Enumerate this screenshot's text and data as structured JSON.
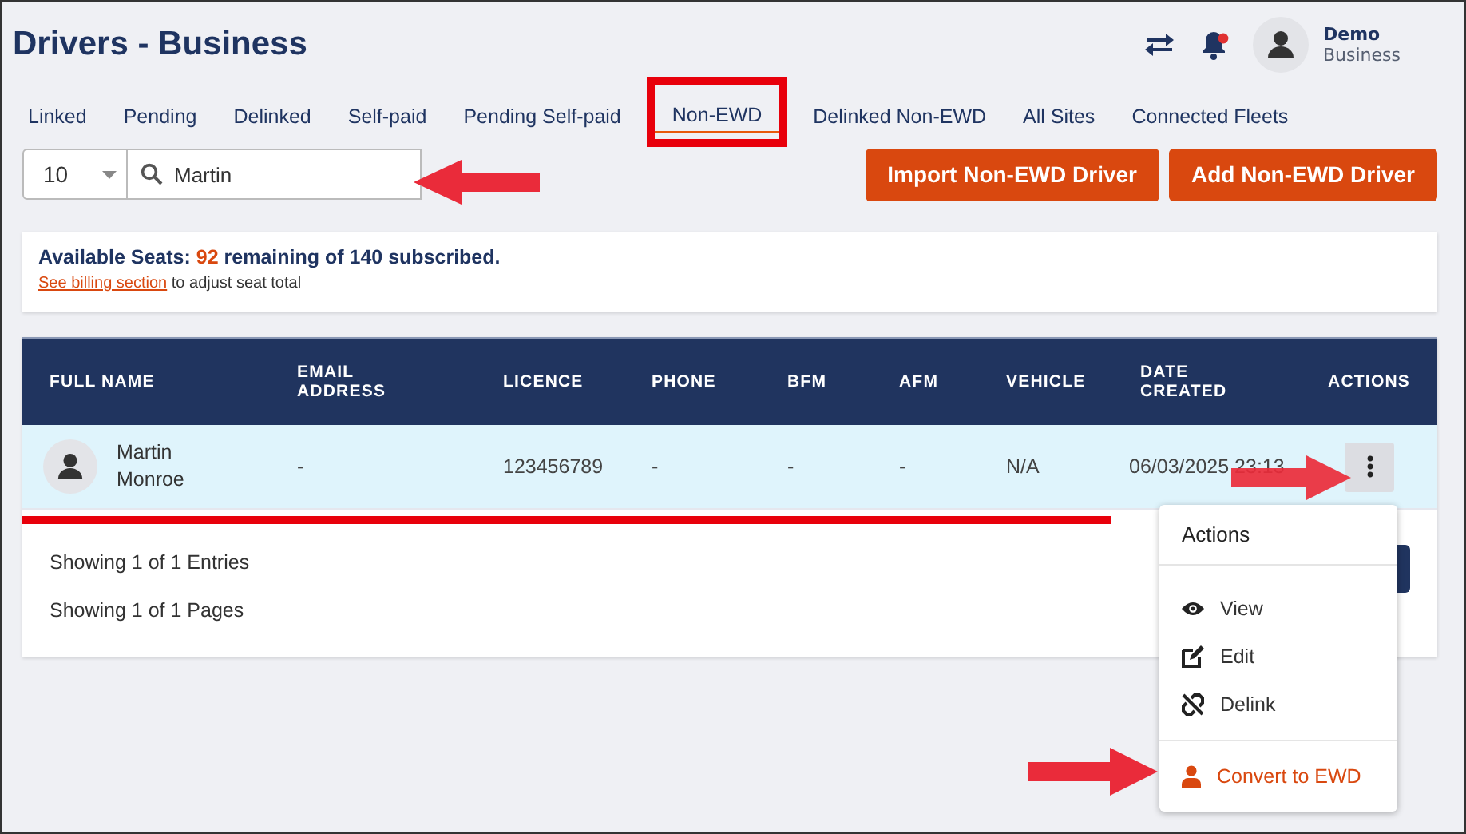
{
  "header": {
    "title": "Drivers - Business",
    "notification_dot": true,
    "user": {
      "name": "Demo",
      "role": "Business"
    }
  },
  "tabs": [
    {
      "label": "Linked",
      "selected": false
    },
    {
      "label": "Pending",
      "selected": false
    },
    {
      "label": "Delinked",
      "selected": false
    },
    {
      "label": "Self-paid",
      "selected": false
    },
    {
      "label": "Pending Self-paid",
      "selected": false
    },
    {
      "label": "Non-EWD",
      "selected": true
    },
    {
      "label": "Delinked Non-EWD",
      "selected": false
    },
    {
      "label": "All Sites",
      "selected": false
    },
    {
      "label": "Connected Fleets",
      "selected": false
    }
  ],
  "page_size": "10",
  "search": {
    "value": "Martin"
  },
  "buttons": [
    "Import Non-EWD Driver",
    "Add Non-EWD Driver"
  ],
  "seats": {
    "label": "Available Seats:",
    "available": "92",
    "rest": "remaining of 140 subscribed.",
    "link": "See billing section",
    "link_suffix": "to adjust seat total"
  },
  "table": {
    "columns": [
      "FULL NAME",
      "EMAIL ADDRESS",
      "LICENCE",
      "PHONE",
      "BFM",
      "AFM",
      "VEHICLE",
      "DATE CREATED",
      "ACTIONS"
    ],
    "rows": [
      {
        "name": "Martin Monroe",
        "email": "-",
        "licence": "123456789",
        "phone": "-",
        "bfm": "-",
        "afm": "-",
        "vehicle": "N/A",
        "date_created": "06/03/2025 23:13",
        "selected": true
      }
    ]
  },
  "footer": {
    "entries": "Showing 1 of 1 Entries",
    "pages": "Showing 1 of 1 Pages"
  },
  "menu": {
    "title": "Actions",
    "items": [
      {
        "label": "View",
        "kind": "normal"
      },
      {
        "label": "Edit",
        "kind": "normal"
      },
      {
        "label": "Delink",
        "kind": "normal"
      },
      {
        "label": "Convert to EWD",
        "kind": "accent"
      }
    ]
  }
}
